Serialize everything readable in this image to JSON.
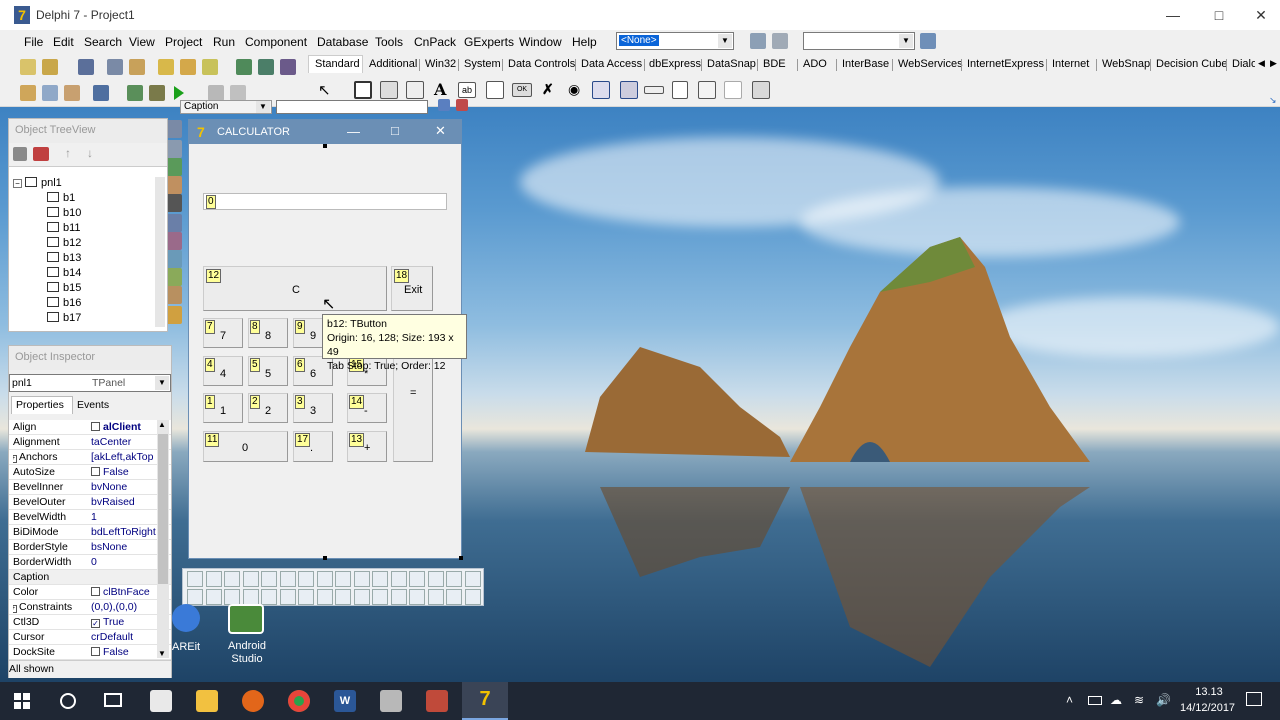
{
  "app": {
    "title": "Delphi 7 - Project1"
  },
  "menu": [
    "File",
    "Edit",
    "Search",
    "View",
    "Project",
    "Run",
    "Component",
    "Database",
    "Tools",
    "CnPack",
    "GExperts",
    "Window",
    "Help"
  ],
  "toolbar": {
    "config_combo": "<None>",
    "palette_tabs": [
      "Standard",
      "Additional",
      "Win32",
      "System",
      "Data Controls",
      "Data Access",
      "dbExpress",
      "DataSnap",
      "BDE",
      "ADO",
      "InterBase",
      "WebServices",
      "InternetExpress",
      "Internet",
      "WebSnap",
      "Decision Cube",
      "Dialo"
    ],
    "caption_combo": "Caption"
  },
  "treeview": {
    "title": "Object TreeView",
    "root": "pnl1",
    "items": [
      "b1",
      "b10",
      "b11",
      "b12",
      "b13",
      "b14",
      "b15",
      "b16",
      "b17"
    ]
  },
  "inspector": {
    "title": "Object Inspector",
    "object_name": "pnl1",
    "object_type": "TPanel",
    "tabs": [
      "Properties",
      "Events"
    ],
    "rows": [
      {
        "name": "Align",
        "value": "alClient",
        "expand": "",
        "check": "box"
      },
      {
        "name": "Alignment",
        "value": "taCenter",
        "expand": "",
        "check": ""
      },
      {
        "name": "Anchors",
        "value": "[akLeft,akTop",
        "expand": "+",
        "check": ""
      },
      {
        "name": "AutoSize",
        "value": "False",
        "expand": "",
        "check": "box"
      },
      {
        "name": "BevelInner",
        "value": "bvNone",
        "expand": "",
        "check": ""
      },
      {
        "name": "BevelOuter",
        "value": "bvRaised",
        "expand": "",
        "check": ""
      },
      {
        "name": "BevelWidth",
        "value": "1",
        "expand": "",
        "check": ""
      },
      {
        "name": "BiDiMode",
        "value": "bdLeftToRight",
        "expand": "",
        "check": ""
      },
      {
        "name": "BorderStyle",
        "value": "bsNone",
        "expand": "",
        "check": ""
      },
      {
        "name": "BorderWidth",
        "value": "0",
        "expand": "",
        "check": ""
      },
      {
        "name": "Caption",
        "value": "",
        "expand": "",
        "check": ""
      },
      {
        "name": "Color",
        "value": "clBtnFace",
        "expand": "",
        "check": "box"
      },
      {
        "name": "Constraints",
        "value": "(0,0),(0,0)",
        "expand": "+",
        "check": ""
      },
      {
        "name": "Ctl3D",
        "value": "True",
        "expand": "",
        "check": "checked"
      },
      {
        "name": "Cursor",
        "value": "crDefault",
        "expand": "",
        "check": ""
      },
      {
        "name": "DockSite",
        "value": "False",
        "expand": "",
        "check": "box"
      }
    ],
    "status": "All shown"
  },
  "form": {
    "title": "CALCULATOR",
    "display_value": "0",
    "display_tag": "0",
    "buttons": [
      {
        "id": "c",
        "tag": "12",
        "label": "C"
      },
      {
        "id": "exit",
        "tag": "18",
        "label": "Exit"
      },
      {
        "id": "7",
        "tag": "7",
        "label": "7"
      },
      {
        "id": "8",
        "tag": "8",
        "label": "8"
      },
      {
        "id": "9",
        "tag": "9",
        "label": "9"
      },
      {
        "id": "4",
        "tag": "4",
        "label": "4"
      },
      {
        "id": "5",
        "tag": "5",
        "label": "5"
      },
      {
        "id": "6",
        "tag": "6",
        "label": "6"
      },
      {
        "id": "mul",
        "tag": "15",
        "label": "*"
      },
      {
        "id": "1",
        "tag": "1",
        "label": "1"
      },
      {
        "id": "2",
        "tag": "2",
        "label": "2"
      },
      {
        "id": "3",
        "tag": "3",
        "label": "3"
      },
      {
        "id": "minus",
        "tag": "14",
        "label": "-"
      },
      {
        "id": "eq",
        "tag": "",
        "label": "="
      },
      {
        "id": "0",
        "tag": "11",
        "label": "0"
      },
      {
        "id": "dot",
        "tag": "17",
        "label": "."
      },
      {
        "id": "plus",
        "tag": "13",
        "label": "+"
      }
    ]
  },
  "tooltip": {
    "line1": "b12: TButton",
    "line2": "Origin: 16, 128; Size: 193 x 49",
    "line3": "Tab Stop: True; Order: 12"
  },
  "desktop_icons": [
    {
      "label": "AREit"
    },
    {
      "label": "Android Studio"
    }
  ],
  "taskbar": {
    "time": "13.13",
    "date": "14/12/2017"
  }
}
